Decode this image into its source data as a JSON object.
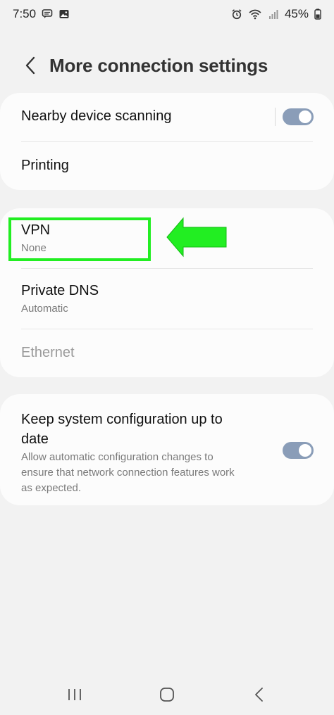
{
  "status_bar": {
    "time": "7:50",
    "battery": "45%"
  },
  "header": {
    "title": "More connection settings"
  },
  "section1": {
    "nearby_scanning": {
      "label": "Nearby device scanning",
      "toggle_on": true
    },
    "printing": {
      "label": "Printing"
    }
  },
  "section2": {
    "vpn": {
      "label": "VPN",
      "value": "None"
    },
    "private_dns": {
      "label": "Private DNS",
      "value": "Automatic"
    },
    "ethernet": {
      "label": "Ethernet",
      "disabled": true
    }
  },
  "section3": {
    "keep_updated": {
      "label_line1": "Keep system configuration up to",
      "label_line2": "date",
      "desc_line1": "Allow automatic configuration changes to",
      "desc_line2": "ensure that network connection features work",
      "desc_line3": "as expected.",
      "toggle_on": true
    }
  },
  "colors": {
    "toggle_on": "#8a9db8",
    "highlight": "#22ee22",
    "background": "#f2f2f2",
    "card": "#fcfcfc"
  },
  "icons": {
    "back": "chevron-left-icon",
    "nav_recents": "recents-icon",
    "nav_home": "home-icon",
    "nav_back": "back-icon"
  }
}
